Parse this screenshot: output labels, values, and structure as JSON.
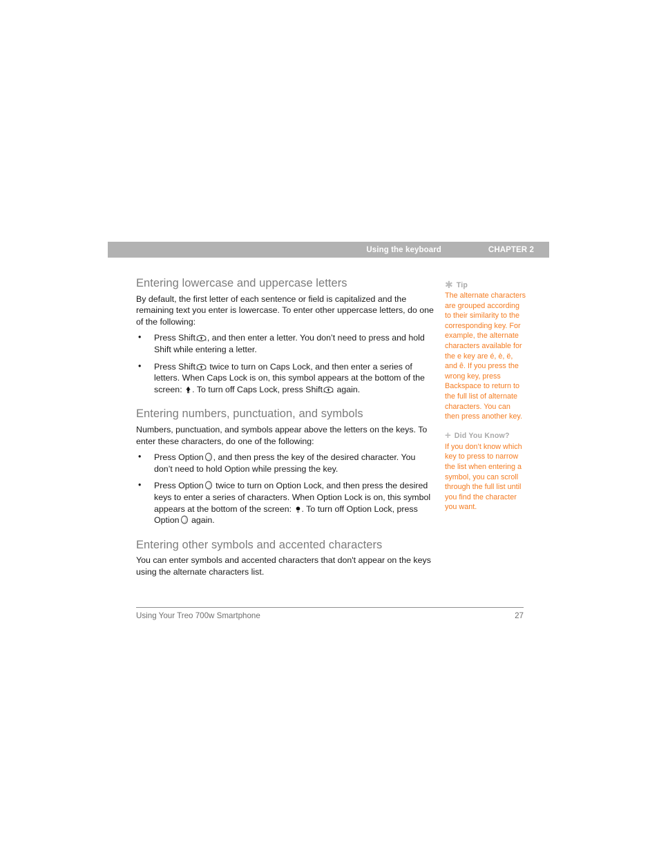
{
  "header": {
    "title": "Using the keyboard",
    "chapter": "CHAPTER 2"
  },
  "sections": [
    {
      "heading": "Entering lowercase and uppercase letters",
      "intro": "By default, the first letter of each sentence or field is capitalized and the remaining text you enter is lowercase. To enter other uppercase letters, do one of the following:",
      "bullets": [
        {
          "part1": "Press Shift",
          "icon1": "shift-key-icon",
          "part2": ", and then enter a letter. You don’t need to press and hold Shift while entering a letter."
        },
        {
          "part1": "Press Shift",
          "icon1": "shift-key-icon",
          "part2": " twice to turn on Caps Lock, and then enter a series of letters. When Caps Lock is on, this symbol appears at the bottom of the screen: ",
          "icon2": "caps-lock-symbol-icon",
          "part3": ". To turn off Caps Lock, press Shift",
          "icon3": "shift-key-icon",
          "part4": " again."
        }
      ]
    },
    {
      "heading": "Entering numbers, punctuation, and symbols",
      "intro": "Numbers, punctuation, and symbols appear above the letters on the keys. To enter these characters, do one of the following:",
      "bullets": [
        {
          "part1": "Press Option",
          "icon1": "option-key-icon",
          "part2": ", and then press the key of the desired character. You don’t need to hold Option while pressing the key."
        },
        {
          "part1": "Press Option",
          "icon1": "option-key-icon",
          "part2": " twice to turn on Option Lock, and then press the desired keys to enter a series of characters. When Option Lock is on, this symbol appears at the bottom of the screen: ",
          "icon2": "option-lock-symbol-icon",
          "part3": ". To turn off Option Lock, press Option",
          "icon3": "option-key-icon",
          "part4": " again."
        }
      ]
    },
    {
      "heading": "Entering other symbols and accented characters",
      "intro": "You can enter symbols and accented characters that don't appear on the keys using the alternate characters list.",
      "bullets": []
    }
  ],
  "notes": [
    {
      "glyph": "asterisk-icon",
      "label": "Tip",
      "body": "The alternate characters are grouped according to their similarity to the corresponding key. For example, the alternate characters available for the e key are é, è, ë, and ê. If you press the wrong key, press Backspace to return to the full list of alternate characters. You can then press another key."
    },
    {
      "glyph": "plus-icon",
      "label": "Did You Know?",
      "body": "If you don’t know which key to press to narrow the list when entering a symbol, you can scroll through the full list until you find the character you want."
    }
  ],
  "footer": {
    "label": "Using Your Treo 700w Smartphone",
    "page": "27"
  },
  "colors": {
    "header_bar": "#b2b2b2",
    "heading_gray": "#7c7c7c",
    "note_orange": "#f47b20",
    "note_label_gray": "#a8a8a8",
    "body_black": "#1a1a1a",
    "footer_gray": "#6f6f6f"
  },
  "glyphs": {
    "asterisk": "✱",
    "plus": "+"
  }
}
